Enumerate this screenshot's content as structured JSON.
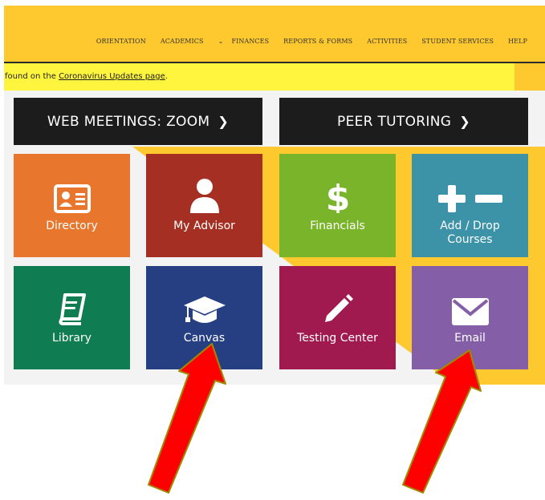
{
  "nav": {
    "items": [
      "ORIENTATION",
      "ACADEMICS",
      "FINANCES",
      "REPORTS & FORMS",
      "ACTIVITIES",
      "STUDENT SERVICES",
      "HELP"
    ],
    "dropdown_glyph": "⌄"
  },
  "banner": {
    "prefix": "found on the ",
    "link": "Coronavirus Updates page",
    "suffix": "."
  },
  "buttons": {
    "zoom": "WEB MEETINGS: ZOOM",
    "tutoring": "PEER TUTORING",
    "arrow": "❯"
  },
  "tiles": [
    {
      "label": "Directory",
      "color": "#e8762c",
      "icon": "id-card-icon"
    },
    {
      "label": "My Advisor",
      "color": "#a52f22",
      "icon": "user-icon"
    },
    {
      "label": "Financials",
      "color": "#7ab42a",
      "icon": "dollar-icon"
    },
    {
      "label": "Add / Drop Courses",
      "color": "#3c93a8",
      "icon": "plus-minus-icon"
    },
    {
      "label": "Library",
      "color": "#107c51",
      "icon": "book-icon"
    },
    {
      "label": "Canvas",
      "color": "#253f82",
      "icon": "graduation-cap-icon"
    },
    {
      "label": "Testing Center",
      "color": "#a01a4f",
      "icon": "pencil-icon"
    },
    {
      "label": "Email",
      "color": "#845ea6",
      "icon": "envelope-icon"
    }
  ],
  "colors": {
    "header": "#fec82f",
    "banner": "#fff53f",
    "dark_button": "#1c1c1c",
    "annotation_arrow": "#ff0000",
    "annotation_outline": "#a08a00"
  }
}
